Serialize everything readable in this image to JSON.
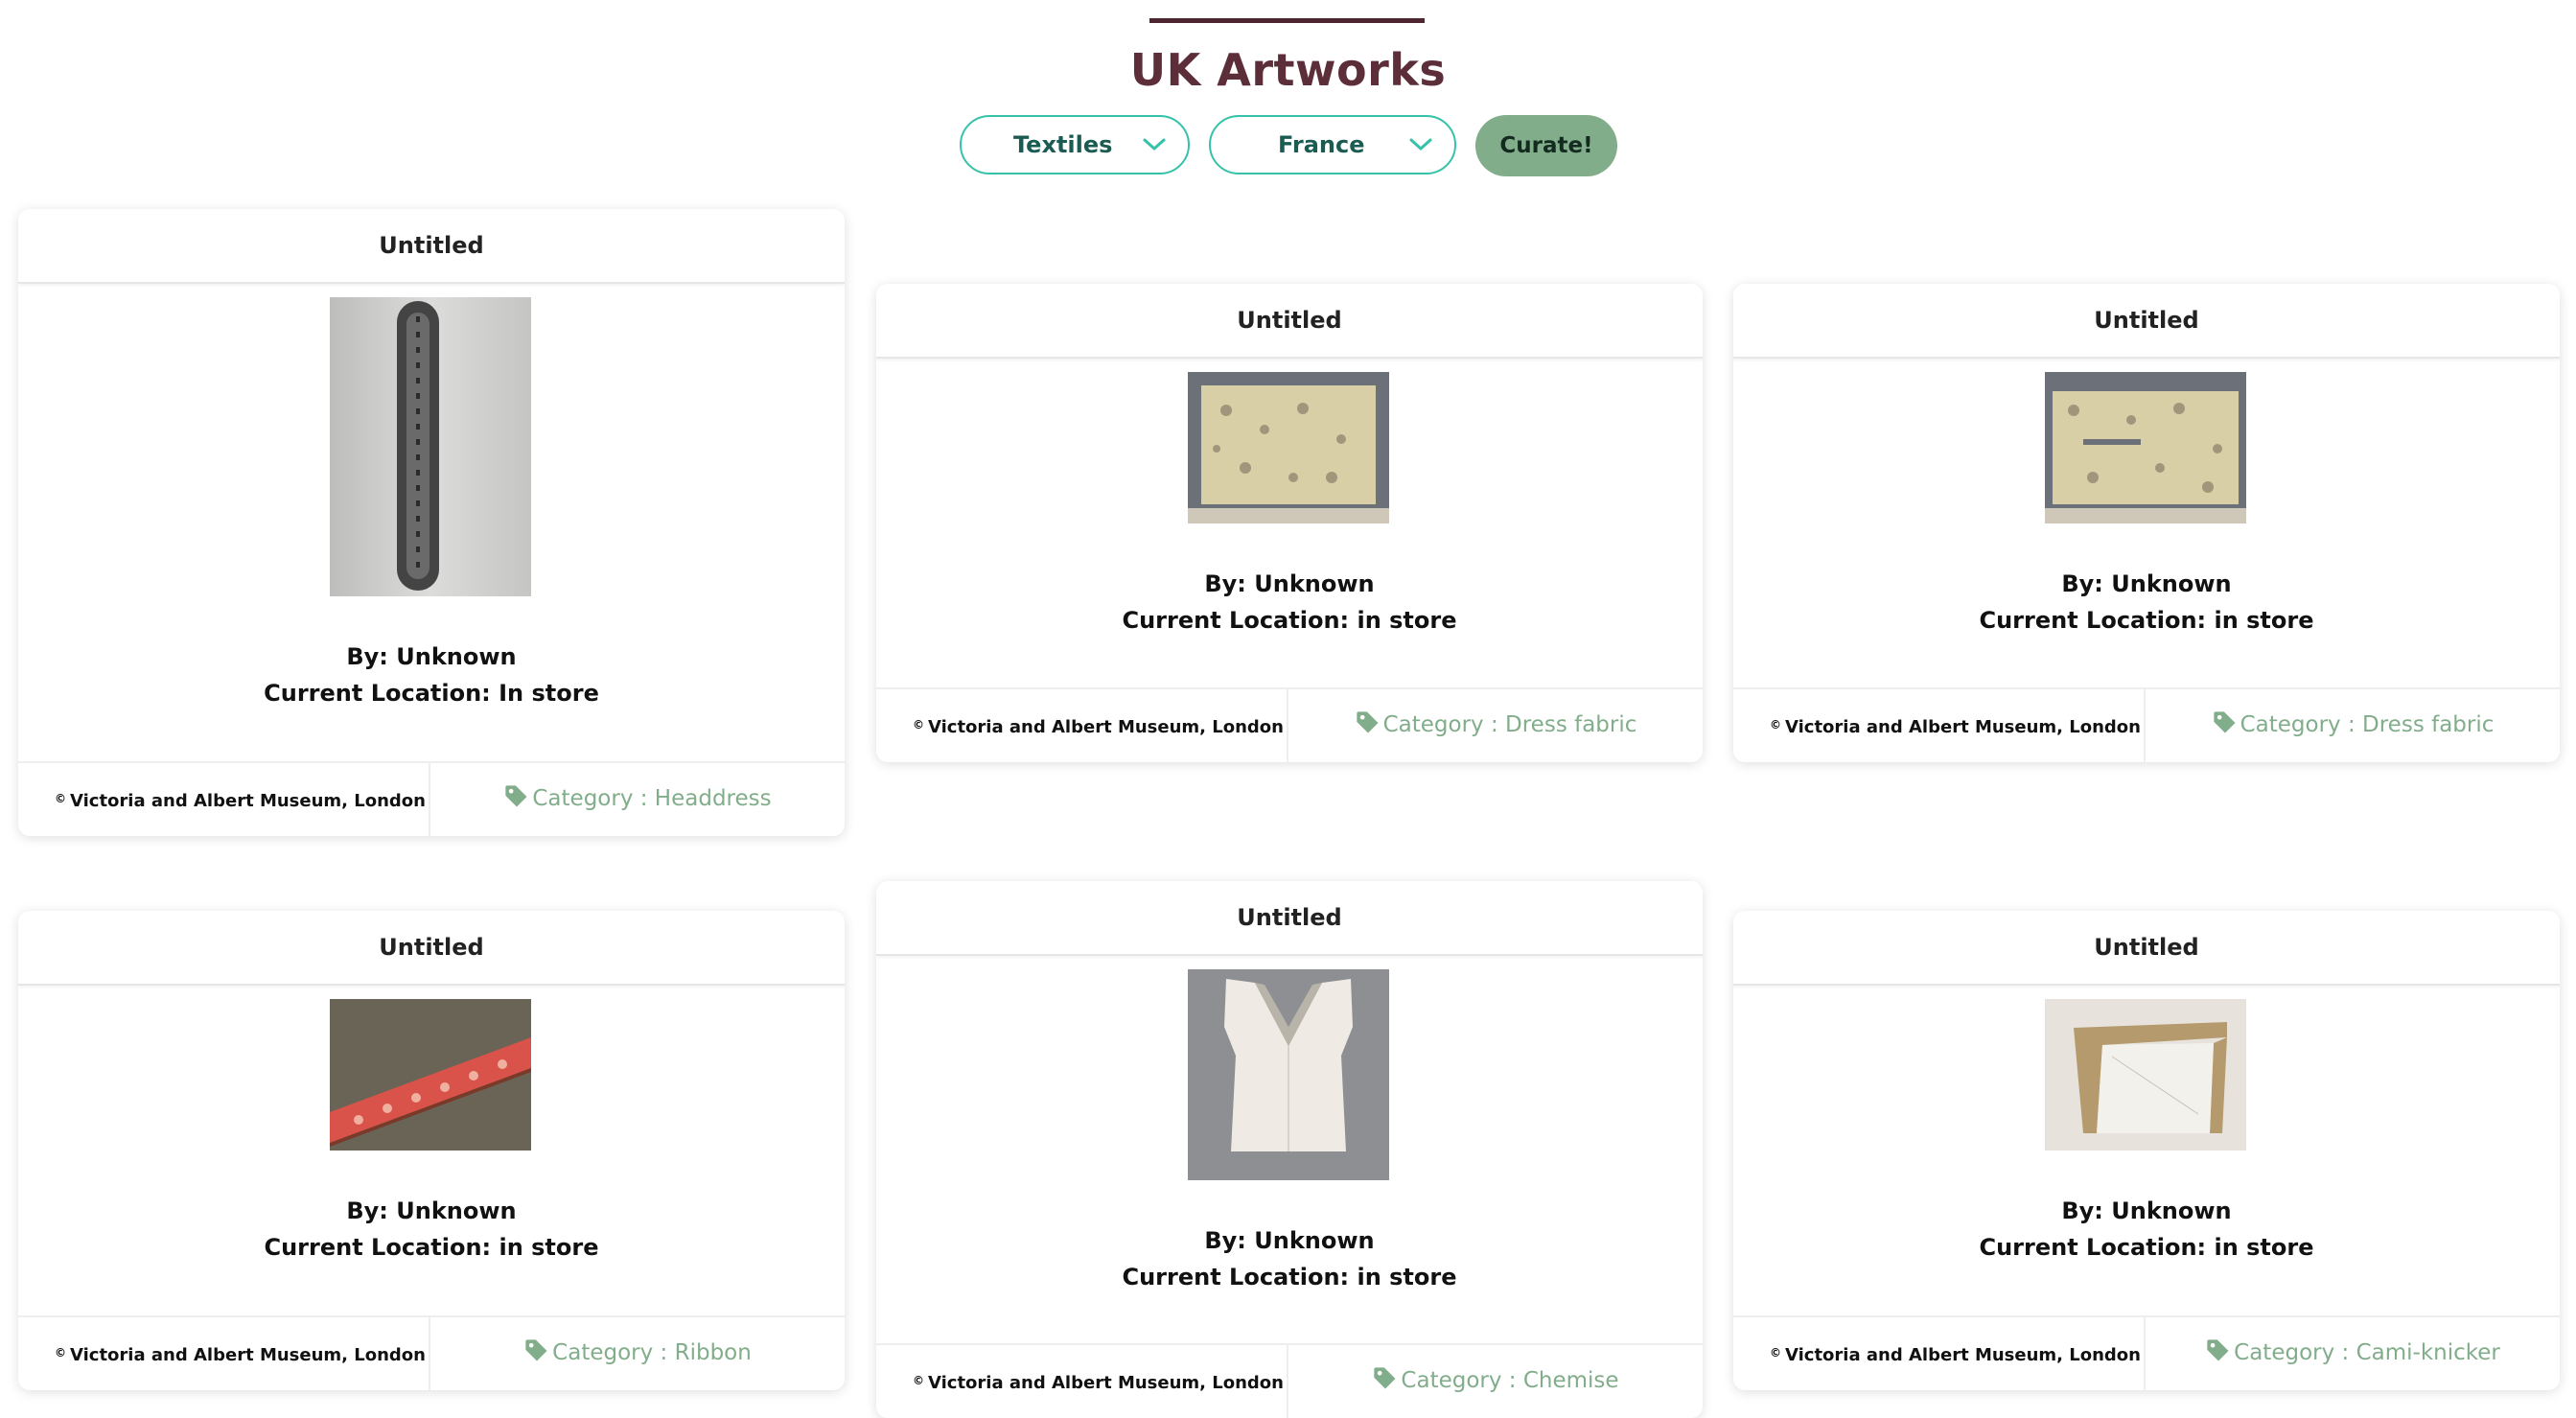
{
  "page": {
    "title": "UK Artworks",
    "accent_color": "#36c2a9",
    "title_color": "#5b2e3a",
    "button_color": "#82ad8b"
  },
  "filters": {
    "category": {
      "selected": "Textiles",
      "icon": "chevron-down-icon"
    },
    "country": {
      "selected": "France",
      "icon": "chevron-down-icon"
    },
    "curate_label": "Curate!"
  },
  "cards": [
    {
      "title": "Untitled",
      "by": "By: Unknown",
      "location": "Current Location: In store",
      "credit": "Victoria and Albert Museum, London",
      "credit_symbol": "©",
      "category": "Category : Headdress",
      "image": "headdress"
    },
    {
      "title": "Untitled",
      "by": "By: Unknown",
      "location": "Current Location: in store",
      "credit": "Victoria and Albert Museum, London",
      "credit_symbol": "©",
      "category": "Category : Dress fabric",
      "image": "dress-fabric"
    },
    {
      "title": "Untitled",
      "by": "By: Unknown",
      "location": "Current Location: in store",
      "credit": "Victoria and Albert Museum, London",
      "credit_symbol": "©",
      "category": "Category : Dress fabric",
      "image": "dress-fabric"
    },
    {
      "title": "Untitled",
      "by": "By: Unknown",
      "location": "Current Location: in store",
      "credit": "Victoria and Albert Museum, London",
      "credit_symbol": "©",
      "category": "Category : Ribbon",
      "image": "ribbon"
    },
    {
      "title": "Untitled",
      "by": "By: Unknown",
      "location": "Current Location: in store",
      "credit": "Victoria and Albert Museum, London",
      "credit_symbol": "©",
      "category": "Category : Chemise",
      "image": "chemise"
    },
    {
      "title": "Untitled",
      "by": "By: Unknown",
      "location": "Current Location: in store",
      "credit": "Victoria and Albert Museum, London",
      "credit_symbol": "©",
      "category": "Category : Cami-knicker",
      "image": "cami-knicker"
    }
  ]
}
